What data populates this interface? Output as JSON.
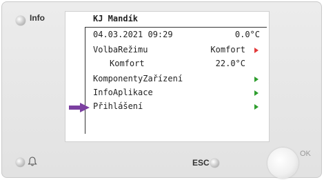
{
  "device": {
    "info_label": "Info",
    "esc_label": "ESC",
    "ok_label": "OK"
  },
  "screen": {
    "title": "KJ Mandík",
    "rows": [
      {
        "label": "04.03.2021 09:29",
        "value": "0.0°C",
        "arrow": "none"
      },
      {
        "label": "VolbaRežimu",
        "value": "Komfort",
        "arrow": "red"
      },
      {
        "label": "   Komfort",
        "value": "22.0°C",
        "arrow": "none"
      },
      {
        "label": "KomponentyZařízení",
        "value": "",
        "arrow": "green"
      },
      {
        "label": "InfoAplikace",
        "value": "",
        "arrow": "green"
      },
      {
        "label": "Přihlášení",
        "value": "",
        "arrow": "green"
      }
    ]
  },
  "colors": {
    "green_arrow": "#2e9e2e",
    "red_arrow": "#e23a3a",
    "pointer": "#7b3fa0"
  },
  "icons": {
    "pointer": "arrow-right-icon",
    "bell": "bell-icon"
  }
}
